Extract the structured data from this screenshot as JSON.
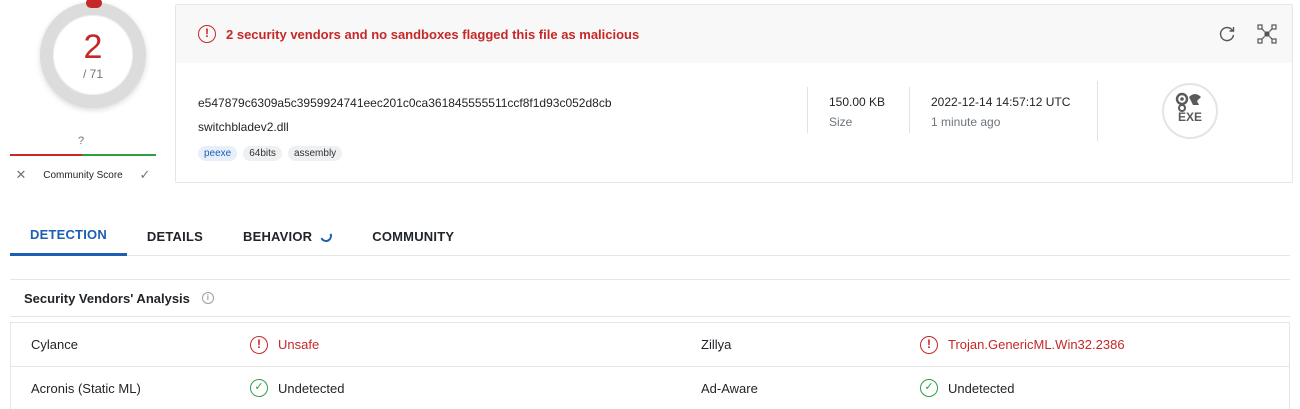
{
  "score": {
    "detections": "2",
    "total": "/ 71"
  },
  "community": {
    "value": "?",
    "label": "Community Score"
  },
  "alert": {
    "text": "2 security vendors and no sandboxes flagged this file as malicious"
  },
  "file": {
    "hash": "e547879c6309a5c3959924741eec201c0ca361845555511ccf8f1d93c052d8cb",
    "name": "switchbladev2.dll",
    "tags": [
      "peexe",
      "64bits",
      "assembly"
    ],
    "size_value": "150.00 KB",
    "size_label": "Size",
    "date_value": "2022-12-14 14:57:12 UTC",
    "date_relative": "1 minute ago",
    "type_label": "EXE"
  },
  "tabs": [
    {
      "label": "DETECTION"
    },
    {
      "label": "DETAILS"
    },
    {
      "label": "BEHAVIOR"
    },
    {
      "label": "COMMUNITY"
    }
  ],
  "section": {
    "title": "Security Vendors' Analysis"
  },
  "vendors": [
    {
      "left_name": "Cylance",
      "left_result": "Unsafe",
      "left_status": "malicious",
      "right_name": "Zillya",
      "right_result": "Trojan.GenericML.Win32.2386",
      "right_status": "malicious"
    },
    {
      "left_name": "Acronis (Static ML)",
      "left_result": "Undetected",
      "left_status": "clean",
      "right_name": "Ad-Aware",
      "right_result": "Undetected",
      "right_status": "clean"
    }
  ],
  "colors": {
    "malicious": "#c62828",
    "clean": "#2e9e44",
    "accent": "#1a5fb4"
  },
  "icons": {
    "alert": "exclamation-circle-icon",
    "reanalyze": "refresh-icon",
    "similar": "graph-icon",
    "info": "info-icon",
    "malicious": "exclamation-circle-icon",
    "clean": "check-circle-icon",
    "file_type": "exe-gear-icon"
  }
}
